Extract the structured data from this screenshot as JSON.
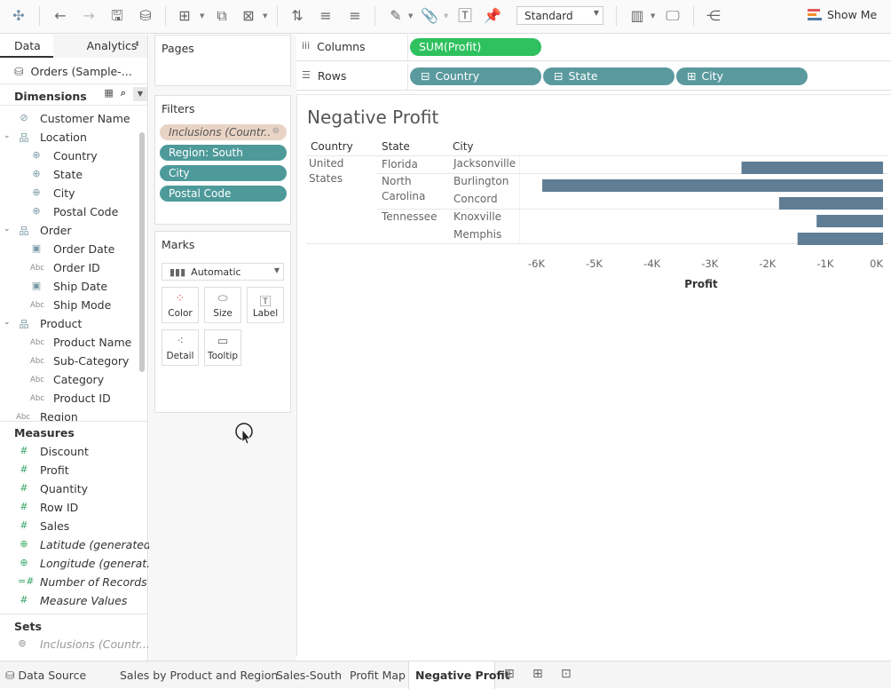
{
  "toolbar": {
    "fit_value": "Standard",
    "show_me_label": "Show Me",
    "show_me_colors": [
      "#e15759",
      "#f28e2b",
      "#4e79a7"
    ]
  },
  "data_pane": {
    "tabs": {
      "data": "Data",
      "analytics": "Analytics"
    },
    "datasource": "Orders (Sample-...",
    "dimensions_header": "Dimensions",
    "dimensions": [
      {
        "label": "Customer Name",
        "icon": "paperclip-icon",
        "indent": 1
      },
      {
        "label": "Location",
        "icon": "hierarchy-icon",
        "indent": 1,
        "expander": true
      },
      {
        "label": "Country",
        "icon": "globe-icon",
        "indent": 2
      },
      {
        "label": "State",
        "icon": "globe-icon",
        "indent": 2
      },
      {
        "label": "City",
        "icon": "globe-icon",
        "indent": 2
      },
      {
        "label": "Postal Code",
        "icon": "globe-icon",
        "indent": 2
      },
      {
        "label": "Order",
        "icon": "hierarchy-icon",
        "indent": 1,
        "expander": true
      },
      {
        "label": "Order Date",
        "icon": "calendar-icon",
        "indent": 2
      },
      {
        "label": "Order ID",
        "icon": "abc-icon",
        "indent": 2
      },
      {
        "label": "Ship Date",
        "icon": "calendar-icon",
        "indent": 2
      },
      {
        "label": "Ship Mode",
        "icon": "abc-icon",
        "indent": 2
      },
      {
        "label": "Product",
        "icon": "hierarchy-icon",
        "indent": 1,
        "expander": true
      },
      {
        "label": "Product Name",
        "icon": "abc-icon",
        "indent": 2
      },
      {
        "label": "Sub-Category",
        "icon": "abc-icon",
        "indent": 2
      },
      {
        "label": "Category",
        "icon": "abc-icon",
        "indent": 2
      },
      {
        "label": "Product ID",
        "icon": "abc-icon",
        "indent": 2
      },
      {
        "label": "Region",
        "icon": "abc-icon",
        "indent": 0
      }
    ],
    "measures_header": "Measures",
    "measures": [
      {
        "label": "Discount",
        "icon": "hash-icon",
        "italic": false
      },
      {
        "label": "Profit",
        "icon": "hash-icon",
        "italic": false
      },
      {
        "label": "Quantity",
        "icon": "hash-icon",
        "italic": false
      },
      {
        "label": "Row ID",
        "icon": "hash-icon",
        "italic": false
      },
      {
        "label": "Sales",
        "icon": "hash-icon",
        "italic": false
      },
      {
        "label": "Latitude (generated)",
        "icon": "globe-icon",
        "italic": true
      },
      {
        "label": "Longitude (generat...",
        "icon": "globe-icon",
        "italic": true
      },
      {
        "label": "Number of Records",
        "icon": "hash-calc-icon",
        "italic": true
      },
      {
        "label": "Measure Values",
        "icon": "hash-icon",
        "italic": true
      }
    ],
    "sets_header": "Sets",
    "sets": [
      {
        "label": "Inclusions (Countr...",
        "icon": "set-icon"
      }
    ]
  },
  "cards": {
    "pages_title": "Pages",
    "filters_title": "Filters",
    "filters": [
      {
        "label": "Inclusions (Countr..",
        "kind": "set"
      },
      {
        "label": "Region: South",
        "kind": "dim"
      },
      {
        "label": "City",
        "kind": "dim"
      },
      {
        "label": "Postal Code",
        "kind": "dim"
      }
    ],
    "marks_title": "Marks",
    "mark_type": "Automatic",
    "mark_buttons": [
      {
        "label": "Color",
        "icon": "color-icon"
      },
      {
        "label": "Size",
        "icon": "size-icon"
      },
      {
        "label": "Label",
        "icon": "label-icon"
      },
      {
        "label": "Detail",
        "icon": "detail-icon"
      },
      {
        "label": "Tooltip",
        "icon": "tooltip-icon"
      }
    ]
  },
  "shelves": {
    "columns_label": "Columns",
    "rows_label": "Rows",
    "columns_pills": [
      "SUM(Profit)"
    ],
    "rows_pills": [
      {
        "label": "Country",
        "toggle": "⊟"
      },
      {
        "label": "State",
        "toggle": "⊟"
      },
      {
        "label": "City",
        "toggle": "⊞"
      }
    ]
  },
  "view": {
    "title": "Negative Profit",
    "headers": {
      "country": "Country",
      "state": "State",
      "city": "City"
    },
    "country": "United States",
    "states": [
      "Florida",
      "North Carolina",
      "Tennessee"
    ]
  },
  "chart_data": {
    "type": "bar",
    "orientation": "horizontal",
    "categories": [
      "Jacksonville",
      "Burlington",
      "Concord",
      "Knoxville",
      "Memphis"
    ],
    "groups": [
      "Florida",
      "North Carolina",
      "North Carolina",
      "Tennessee",
      "Tennessee"
    ],
    "values": [
      -2450,
      -5900,
      -1800,
      -1150,
      -1480
    ],
    "xlim": [
      -6300,
      0
    ],
    "xticks": [
      -6000,
      -5000,
      -4000,
      -3000,
      -2000,
      -1000,
      0
    ],
    "xtick_labels": [
      "-6K",
      "-5K",
      "-4K",
      "-3K",
      "-2K",
      "-1K",
      "0K"
    ],
    "xlabel": "Profit",
    "bar_color": "#5f7d95"
  },
  "tabs": {
    "items": [
      "Data Source",
      "Sales by Product and Region",
      "Sales-South",
      "Profit Map",
      "Negative Profit"
    ],
    "active": "Negative Profit"
  }
}
